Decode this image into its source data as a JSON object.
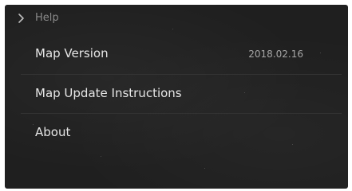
{
  "header": {
    "title": "Help",
    "icon": "chevron-right-icon"
  },
  "menu": {
    "items": [
      {
        "label": "Map Version",
        "value": "2018.02.16"
      },
      {
        "label": "Map Update Instructions"
      },
      {
        "label": "About"
      }
    ]
  },
  "colors": {
    "background": "#1f1f1f",
    "text_primary": "#e6e6e6",
    "text_secondary": "#a6a6a6",
    "header_text": "#8a8a8a",
    "divider": "#333333"
  }
}
